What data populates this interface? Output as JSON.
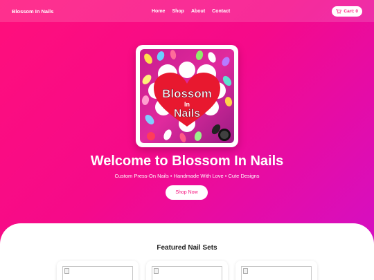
{
  "nav": {
    "brand": "Blossom In Nails",
    "links": [
      "Home",
      "Shop",
      "About",
      "Contact"
    ],
    "cart_label": "Cart: 0"
  },
  "hero": {
    "logo_alt": "Blossom In Nails logo",
    "logo_text_line1": "Blossom",
    "logo_text_line2": "In",
    "logo_text_line3": "Nails",
    "title": "Welcome to Blossom In Nails",
    "subtitle": "Custom Press-On Nails • Handmade With Love • Cute Designs",
    "cta": "Shop Now"
  },
  "featured": {
    "title": "Featured Nail Sets",
    "product_count": 3
  },
  "colors": {
    "gradient_start": "#ff0f7b",
    "gradient_end": "#d10fc9",
    "accent": "#ff1f7f"
  }
}
